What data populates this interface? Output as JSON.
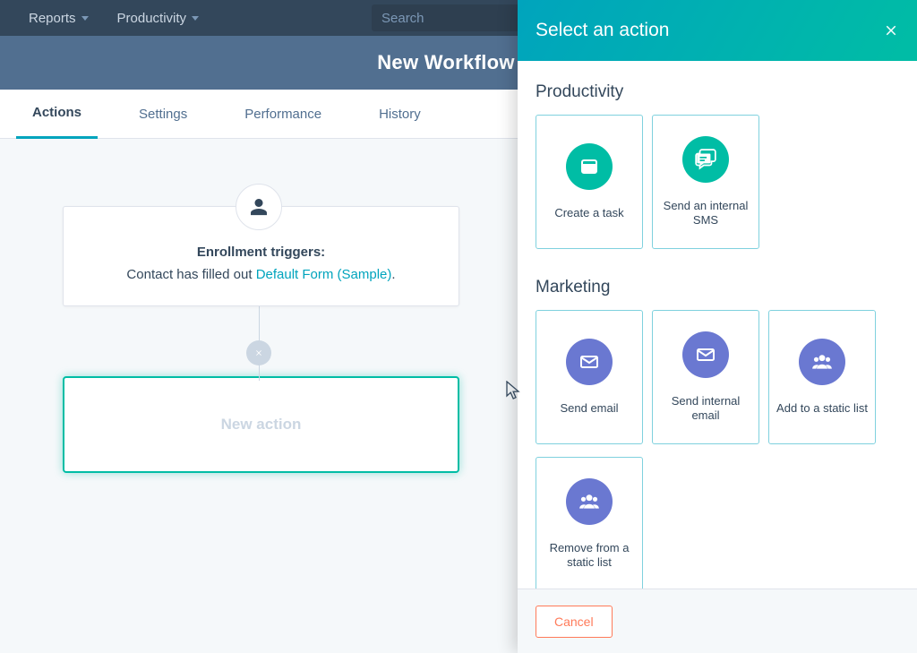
{
  "topnav": {
    "items": [
      "Reports",
      "Productivity"
    ],
    "search_placeholder": "Search"
  },
  "titlebar": {
    "title": "New Workflow"
  },
  "tabs": [
    "Actions",
    "Settings",
    "Performance",
    "History"
  ],
  "active_tab_index": 0,
  "trigger": {
    "heading": "Enrollment triggers:",
    "prefix": "Contact has filled out ",
    "link_text": "Default Form (Sample)",
    "suffix": "."
  },
  "new_action_label": "New action",
  "panel": {
    "title": "Select an action",
    "sections": [
      {
        "title": "Productivity",
        "color": "teal",
        "cards": [
          {
            "id": "create-task",
            "label": "Create a task",
            "icon": "window-icon"
          },
          {
            "id": "send-internal-sms",
            "label": "Send an internal SMS",
            "icon": "chat-icon"
          }
        ]
      },
      {
        "title": "Marketing",
        "color": "pur",
        "cards": [
          {
            "id": "send-email",
            "label": "Send email",
            "icon": "envelope-icon"
          },
          {
            "id": "send-internal-email",
            "label": "Send internal email",
            "icon": "envelope-icon"
          },
          {
            "id": "add-static-list",
            "label": "Add to a static list",
            "icon": "group-icon"
          },
          {
            "id": "remove-static-list",
            "label": "Remove from a static list",
            "icon": "group-icon"
          }
        ]
      }
    ],
    "cancel_label": "Cancel"
  }
}
